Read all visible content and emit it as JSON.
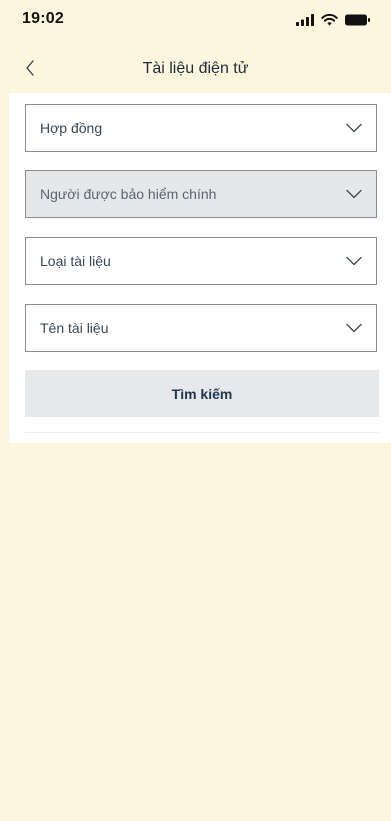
{
  "status_bar": {
    "time": "19:02",
    "icons": [
      "signal-icon",
      "wifi-icon",
      "battery-icon"
    ]
  },
  "nav": {
    "back_icon": "chevron-left-icon",
    "title": "Tài liệu điện tử"
  },
  "form": {
    "fields": [
      {
        "label": "Hợp đồng",
        "disabled": false,
        "icon": "chevron-down-icon"
      },
      {
        "label": "Người được bảo hiểm chính",
        "disabled": true,
        "icon": "chevron-down-icon"
      },
      {
        "label": "Loại tài liệu",
        "disabled": false,
        "icon": "chevron-down-icon"
      },
      {
        "label": "Tên tài liệu",
        "disabled": false,
        "icon": "chevron-down-icon"
      }
    ],
    "search_label": "Tìm kiếm"
  },
  "colors": {
    "page_background": "#fdf6df",
    "panel_background": "#ffffff",
    "disabled_field_background": "#e6e7e8",
    "button_background": "#e7e8ea",
    "button_text": "#1e3550",
    "field_border": "#8c8c8c"
  }
}
